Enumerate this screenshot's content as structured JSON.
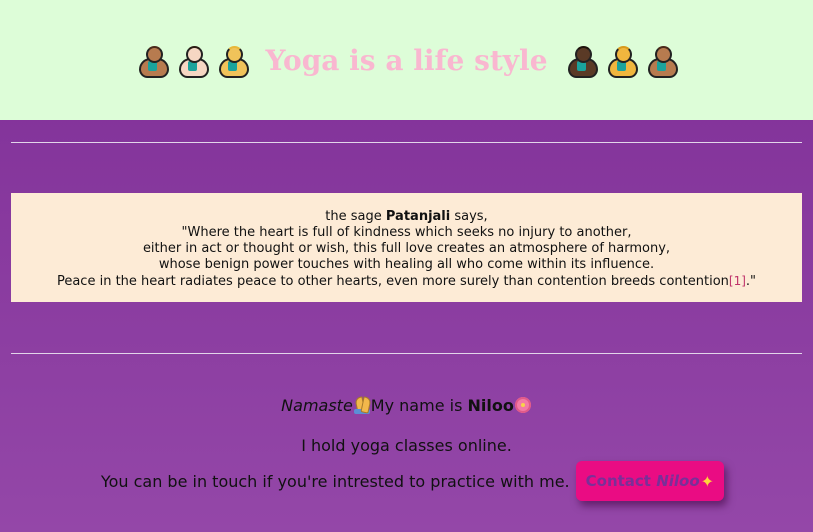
{
  "header": {
    "title": "Yoga is a life style",
    "left_yogis": [
      {
        "icon": "person-in-lotus-position-icon",
        "skin": "#b77b4f",
        "hair": "#4a2a1a"
      },
      {
        "icon": "person-in-lotus-position-icon",
        "skin": "#f6d7c3",
        "hair": "#2b1c14"
      },
      {
        "icon": "person-in-lotus-position-icon",
        "skin": "#f0c35a",
        "hair": "#e8b83a"
      }
    ],
    "right_yogis": [
      {
        "icon": "person-in-lotus-position-icon",
        "skin": "#5a3a26",
        "hair": "#1e120b"
      },
      {
        "icon": "person-in-lotus-position-icon",
        "skin": "#f0b63e",
        "hair": "#d89a1c"
      },
      {
        "icon": "person-in-lotus-position-icon",
        "skin": "#b77b4f",
        "hair": "#4a2a1a"
      }
    ],
    "background": "#ddfdd8",
    "title_color": "#f9b7d0"
  },
  "quote": {
    "prefix": "the sage ",
    "author": "Patanjali",
    "suffix": " says,",
    "lines": [
      "\"Where the heart is full of kindness which seeks no injury to another,",
      "either in act or thought or wish, this full love creates an atmosphere of harmony,",
      "whose benign power touches with healing all who come within its influence.",
      "Peace in the heart radiates peace to other hearts, even more surely than contention breeds contention"
    ],
    "reference": "[1]",
    "closing": ".\"",
    "background": "#fdebd6"
  },
  "intro": {
    "greeting": "Namaste",
    "greeting_icon": "folded-hands-icon",
    "name_prefix": "My name is ",
    "name": "Niloo",
    "name_icon": "hibiscus-icon",
    "classes_text": "I hold yoga classes online.",
    "contact_text": "You can be in touch if you're intrested to practice with me."
  },
  "contact_button": {
    "label_prefix": "Contact ",
    "label_name": "Niloo",
    "icon": "sparkles-icon",
    "background": "#ea0c83"
  }
}
